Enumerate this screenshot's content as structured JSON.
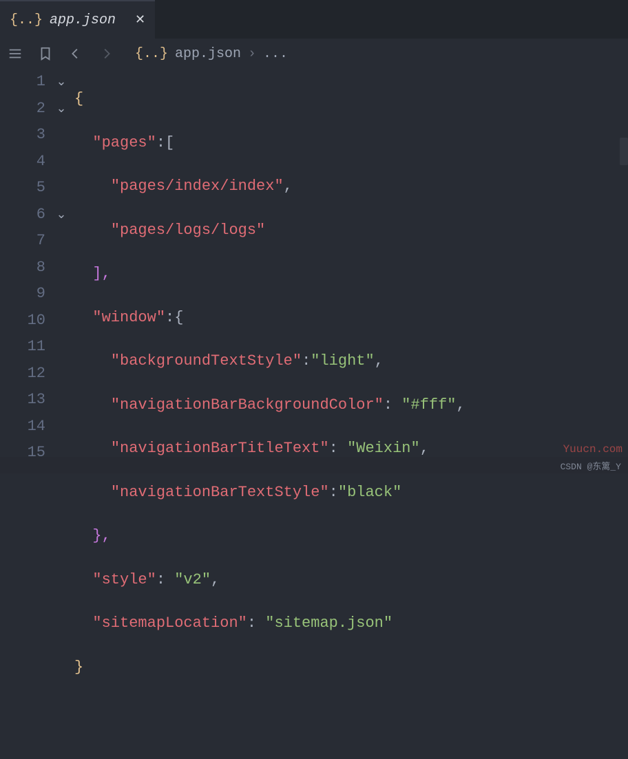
{
  "tab": {
    "filename": "app.json",
    "icon": "json-file-icon"
  },
  "breadcrumb": {
    "filename": "app.json",
    "more": "..."
  },
  "gutter": {
    "lines": [
      "1",
      "2",
      "3",
      "4",
      "5",
      "6",
      "7",
      "8",
      "9",
      "10",
      "11",
      "12",
      "13",
      "14",
      "15"
    ]
  },
  "folds": {
    "1": "v",
    "2": "v",
    "6": "v"
  },
  "code": {
    "l1_brace": "{",
    "l2_key": "\"pages\"",
    "l2_colon_bracket": ":[",
    "l3_val": "\"pages/index/index\"",
    "l3_comma": ",",
    "l4_val": "\"pages/logs/logs\"",
    "l5_close": "],",
    "l6_key": "\"window\"",
    "l6_colon_brace": ":{",
    "l7_key": "\"backgroundTextStyle\"",
    "l7_colon": ":",
    "l7_val": "\"light\"",
    "l7_comma": ",",
    "l8_key": "\"navigationBarBackgroundColor\"",
    "l8_colon": ": ",
    "l8_val": "\"#fff\"",
    "l8_comma": ",",
    "l9_key": "\"navigationBarTitleText\"",
    "l9_colon": ": ",
    "l9_val": "\"Weixin\"",
    "l9_comma": ",",
    "l10_key": "\"navigationBarTextStyle\"",
    "l10_colon": ":",
    "l10_val": "\"black\"",
    "l11_close": "},",
    "l12_key": "\"style\"",
    "l12_colon": ": ",
    "l12_val": "\"v2\"",
    "l12_comma": ",",
    "l13_key": "\"sitemapLocation\"",
    "l13_colon": ": ",
    "l13_val": "\"sitemap.json\"",
    "l14_brace": "}"
  },
  "watermark": "Yuucn.com",
  "status": "CSDN @东篱_Y"
}
